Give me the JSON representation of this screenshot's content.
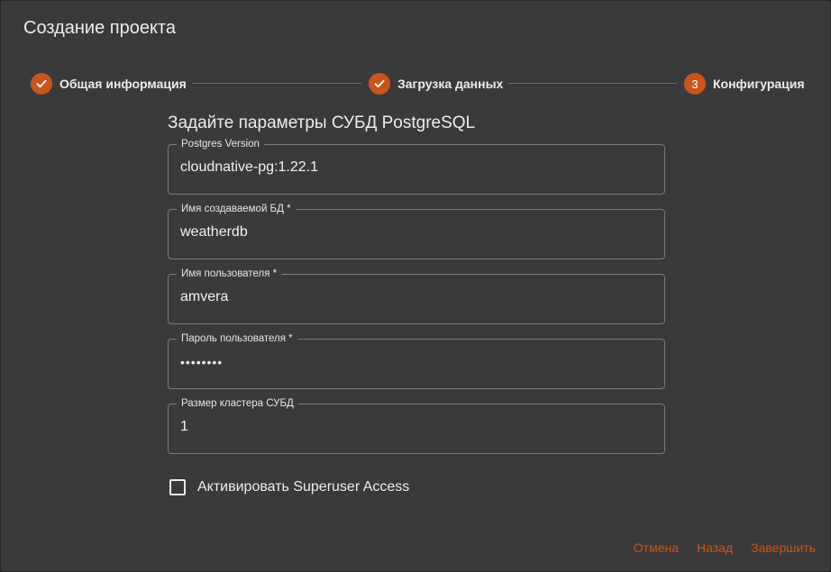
{
  "dialog": {
    "title": "Создание проекта"
  },
  "stepper": {
    "steps": [
      {
        "label": "Общая информация",
        "state": "done",
        "icon": "check-icon"
      },
      {
        "label": "Загрузка данных",
        "state": "done",
        "icon": "check-icon"
      },
      {
        "label": "Конфигурация",
        "state": "active",
        "number": "3"
      }
    ]
  },
  "form": {
    "heading": "Задайте параметры СУБД PostgreSQL",
    "fields": [
      {
        "label": "Postgres Version",
        "value": "cloudnative-pg:1.22.1"
      },
      {
        "label": "Имя создаваемой БД *",
        "value": "weatherdb"
      },
      {
        "label": "Имя пользователя *",
        "value": "amvera"
      },
      {
        "label": "Пароль пользователя *",
        "value": "••••••••"
      },
      {
        "label": "Размер кластера СУБД",
        "value": "1"
      }
    ],
    "superuser_checkbox": {
      "label": "Активировать Superuser Access",
      "checked": false
    }
  },
  "actions": {
    "cancel": "Отмена",
    "back": "Назад",
    "finish": "Завершить"
  },
  "colors": {
    "accent": "#c8551e",
    "background": "#3a3a3a",
    "outline": "#7a7a7a"
  }
}
